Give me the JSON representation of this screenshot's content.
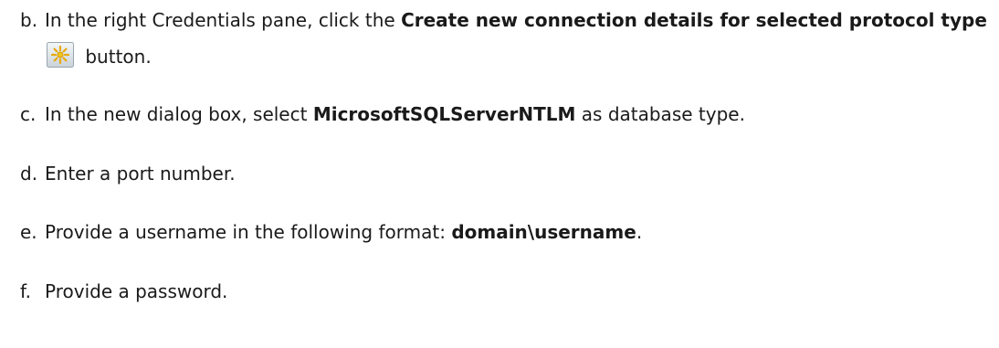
{
  "steps": [
    {
      "marker": "b.",
      "text_before": "In the right Credentials pane, click the ",
      "bold": "Create new connection details for selected protocol type",
      "icon": "new-connection-details-icon",
      "text_after": " button."
    },
    {
      "marker": "c.",
      "text_before": "In the new dialog box, select ",
      "bold": "MicrosoftSQLServerNTLM",
      "text_after": " as database type."
    },
    {
      "marker": "d.",
      "text": "Enter a port number."
    },
    {
      "marker": "e.",
      "text_before": "Provide a username in the following format: ",
      "bold": "domain\\username",
      "text_after": "."
    },
    {
      "marker": "f.",
      "text": "Provide a password."
    }
  ],
  "colors": {
    "text": "#1a1a1a",
    "icon_frame": "#9aa5ae",
    "icon_bg": "#dfe6ec",
    "icon_star": "#f5c518"
  }
}
